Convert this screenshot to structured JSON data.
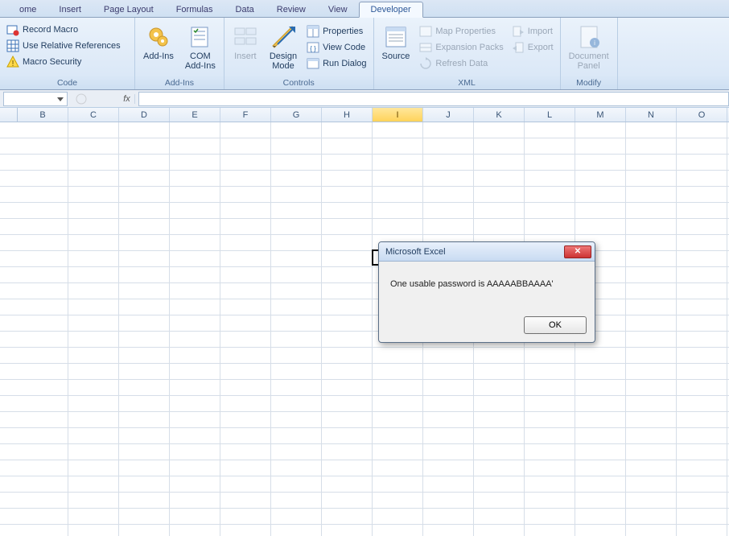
{
  "tabs": {
    "items": [
      "ome",
      "Insert",
      "Page Layout",
      "Formulas",
      "Data",
      "Review",
      "View",
      "Developer"
    ],
    "active_index": 7
  },
  "ribbon": {
    "code": {
      "label": "Code",
      "record_macro": "Record Macro",
      "use_relative": "Use Relative References",
      "macro_security": "Macro Security"
    },
    "addins": {
      "label": "Add-Ins",
      "addins_btn": "Add-Ins",
      "com_addins_l1": "COM",
      "com_addins_l2": "Add-Ins"
    },
    "controls": {
      "label": "Controls",
      "insert": "Insert",
      "design_l1": "Design",
      "design_l2": "Mode",
      "properties": "Properties",
      "view_code": "View Code",
      "run_dialog": "Run Dialog"
    },
    "xml": {
      "label": "XML",
      "source": "Source",
      "map_properties": "Map Properties",
      "expansion_packs": "Expansion Packs",
      "refresh_data": "Refresh Data",
      "import": "Import",
      "export": "Export"
    },
    "modify": {
      "label": "Modify",
      "document_l1": "Document",
      "document_l2": "Panel"
    }
  },
  "formula_bar": {
    "fx": "fx",
    "name": "",
    "formula": ""
  },
  "columns": [
    "B",
    "C",
    "D",
    "E",
    "F",
    "G",
    "H",
    "I",
    "J",
    "K",
    "L",
    "M",
    "N",
    "O"
  ],
  "active_col_index": 7,
  "dialog": {
    "title": "Microsoft Excel",
    "message": "One usable password is AAAAABBAAAA'",
    "ok": "OK"
  }
}
